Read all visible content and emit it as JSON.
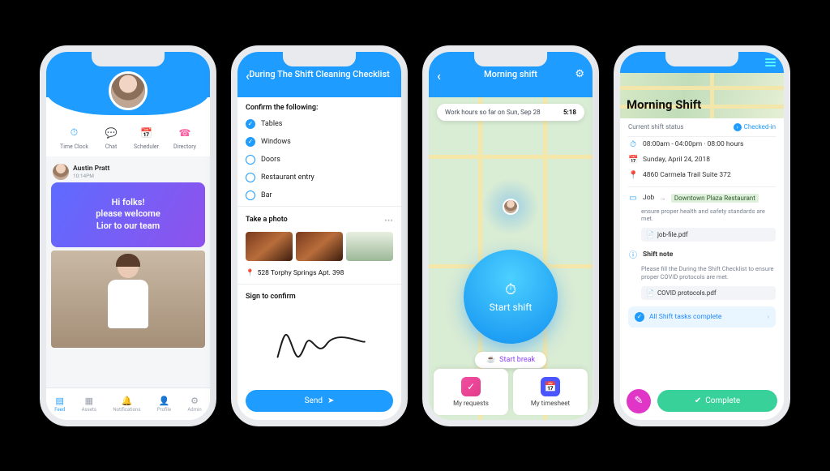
{
  "phone1": {
    "quick": [
      {
        "icon": "⏱",
        "label": "Time Clock",
        "color": "#1e9cff"
      },
      {
        "icon": "💬",
        "label": "Chat",
        "color": "#31c46b"
      },
      {
        "icon": "📅",
        "label": "Scheduler",
        "color": "#f5c20a"
      },
      {
        "icon": "☎",
        "label": "Directory",
        "color": "#ff5fa2"
      }
    ],
    "post": {
      "author": "Austin Pratt",
      "time": "10:14PM"
    },
    "welcome_line1": "Hi folks!",
    "welcome_line2": "please welcome",
    "welcome_line3": "Lior to our team",
    "tabs": [
      "Feed",
      "Assets",
      "Notifications",
      "Profile",
      "Admin"
    ]
  },
  "phone2": {
    "title": "During The Shift Cleaning Checklist",
    "confirm_label": "Confirm the following:",
    "items": [
      {
        "label": "Tables",
        "checked": true
      },
      {
        "label": "Windows",
        "checked": true
      },
      {
        "label": "Doors",
        "checked": false
      },
      {
        "label": "Restaurant entry",
        "checked": false
      },
      {
        "label": "Bar",
        "checked": false
      }
    ],
    "photo_label": "Take a photo",
    "address": "528 Torphy Springs Apt. 398",
    "sign_label": "Sign to confirm",
    "send_label": "Send"
  },
  "phone3": {
    "title": "Morning shift",
    "hours_label": "Work hours so far on Sun, Sep 28",
    "hours_value": "5:18",
    "start_label": "Start shift",
    "break_label": "Start break",
    "cards": [
      {
        "icon": "✓",
        "label": "My requests",
        "bg": "linear-gradient(135deg,#f04fa1,#e43b8c)"
      },
      {
        "icon": "📅",
        "label": "My timesheet",
        "bg": "#4b55ff"
      }
    ]
  },
  "phone4": {
    "title": "Morning Shift",
    "status_label": "Current shift status",
    "status_value": "Checked-in",
    "time": "08:00am - 04:00pm · 08:00 hours",
    "date": "Sunday, April 24, 2018",
    "address": "4860 Carmela Trail Suite 372",
    "job_label": "Job",
    "job_value": "Downtown Plaza Restaurant",
    "note1": "ensure proper health and safety standards are met.",
    "file1": "job-file.pdf",
    "shiftnote_label": "Shift note",
    "shiftnote_text": "Please fill the During the Shift Checklist to ensure proper COVID protocols are met.",
    "file2": "COVID protocols.pdf",
    "tasks_label": "All Shift tasks complete",
    "complete_label": "Complete"
  }
}
